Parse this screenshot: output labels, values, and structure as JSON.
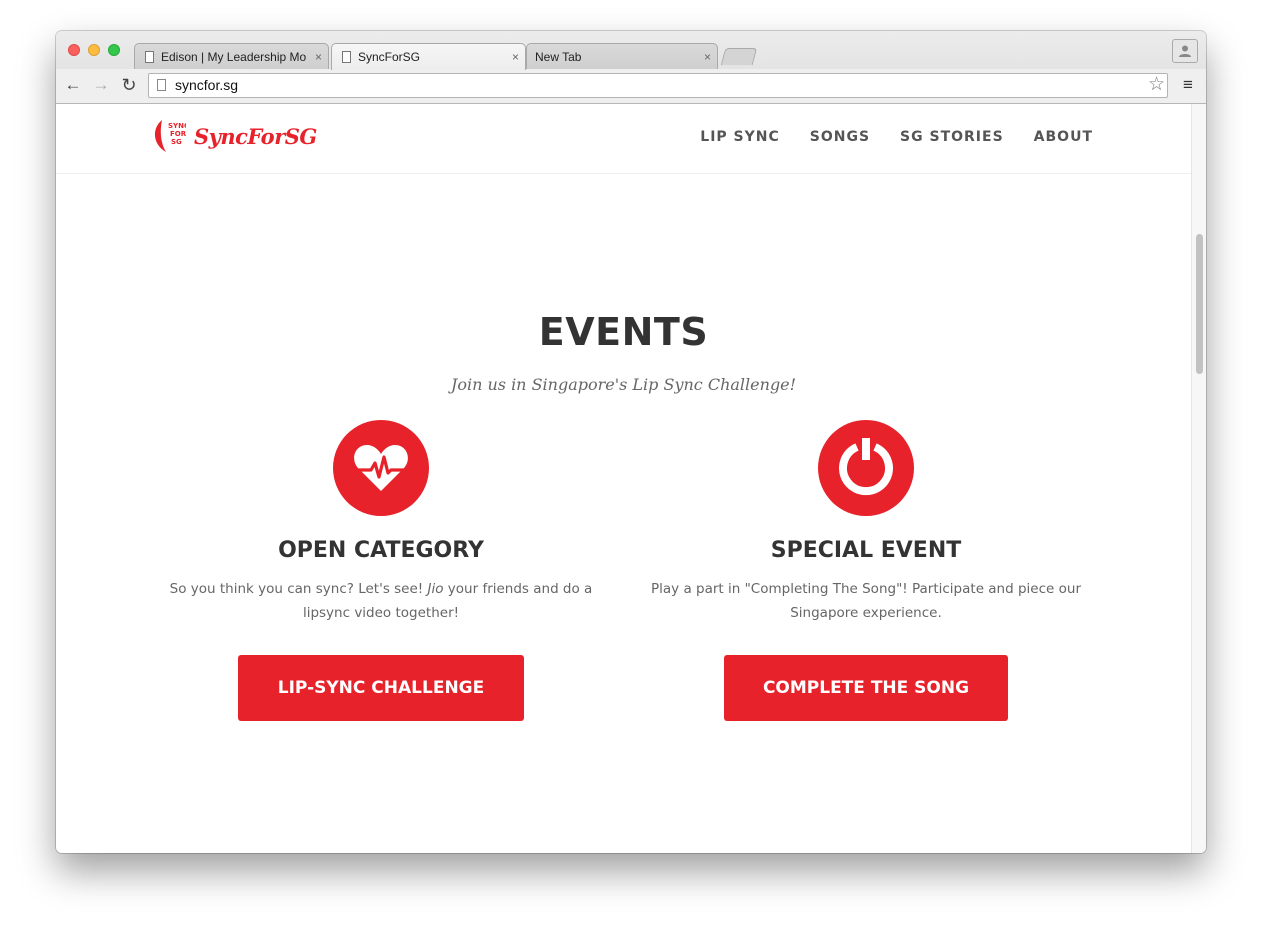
{
  "browser": {
    "tabs": [
      {
        "title": "Edison | My Leadership Mo",
        "close": "×"
      },
      {
        "title": "SyncForSG",
        "close": "×"
      },
      {
        "title": "New Tab",
        "close": "×"
      }
    ],
    "url": "syncfor.sg",
    "icons": {
      "back": "←",
      "forward": "→",
      "reload": "↻",
      "star": "☆",
      "menu": "≡",
      "profile": "👤"
    }
  },
  "site": {
    "logo_badge_text": "SYNC FOR SG",
    "logo_text": "SyncForSG",
    "brand_color": "#e8222b",
    "nav": [
      "LIP SYNC",
      "SONGS",
      "SG STORIES",
      "ABOUT"
    ]
  },
  "events": {
    "title": "EVENTS",
    "subtitle": "Join us in Singapore's Lip Sync Challenge!",
    "cards": [
      {
        "icon": "heart-pulse-icon",
        "title": "OPEN CATEGORY",
        "desc_pre": "So you think you can sync? Let's see! ",
        "desc_em": "Jio",
        "desc_post": " your friends and do a lipsync video together!",
        "button": "LIP-SYNC CHALLENGE"
      },
      {
        "icon": "power-icon",
        "title": "SPECIAL EVENT",
        "desc": "Play a part in \"Completing The Song\"! Participate and piece our Singapore experience.",
        "button": "COMPLETE THE SONG"
      }
    ]
  }
}
